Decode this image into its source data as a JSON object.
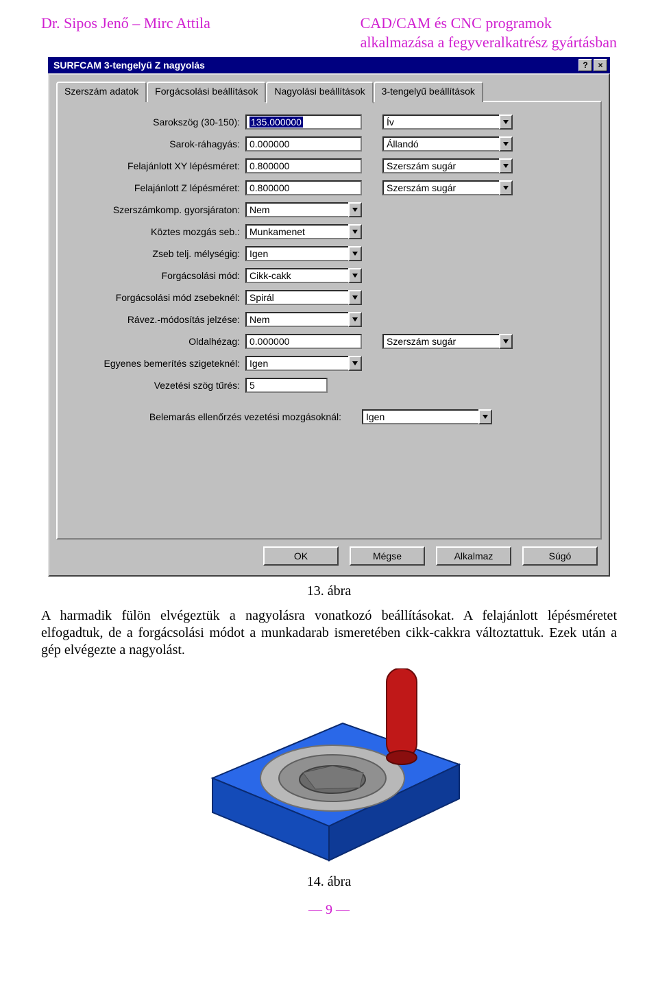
{
  "header": {
    "left": "Dr. Sipos Jenő – Mirc Attila",
    "right_line1": "CAD/CAM és CNC programok",
    "right_line2": "alkalmazása a fegyveralkatrész gyártásban"
  },
  "dialog": {
    "title": "SURFCAM 3-tengelyű Z nagyolás",
    "help_btn": "?",
    "close_btn": "×",
    "tabs": [
      {
        "label": "Szerszám adatok",
        "active": false
      },
      {
        "label": "Forgácsolási beállítások",
        "active": false
      },
      {
        "label": "Nagyolási  beállítások",
        "active": true
      },
      {
        "label": "3-tengelyű beállítások",
        "active": false
      }
    ],
    "rows": [
      {
        "label": "Sarokszög (30-150):",
        "value": "135.000000",
        "highlight": true,
        "combo": false,
        "right": {
          "value": "Ív",
          "combo": true
        }
      },
      {
        "label": "Sarok-ráhagyás:",
        "value": "0.000000",
        "combo": false,
        "right": {
          "value": "Állandó",
          "combo": true
        }
      },
      {
        "label": "Felajánlott XY lépésméret:",
        "value": "0.800000",
        "combo": false,
        "right": {
          "value": "Szerszám sugár",
          "combo": true
        }
      },
      {
        "label": "Felajánlott Z lépésméret:",
        "value": "0.800000",
        "combo": false,
        "right": {
          "value": "Szerszám sugár",
          "combo": true
        }
      },
      {
        "label": "Szerszámkomp. gyorsjáraton:",
        "value": "Nem",
        "combo": true
      },
      {
        "label": "Köztes mozgás seb.:",
        "value": "Munkamenet",
        "combo": true
      },
      {
        "label": "Zseb telj. mélységig:",
        "value": "Igen",
        "combo": true
      },
      {
        "label": "Forgácsolási mód:",
        "value": "Cikk-cakk",
        "combo": true
      },
      {
        "label": "Forgácsolási mód zsebeknél:",
        "value": "Spirál",
        "combo": true
      },
      {
        "label": "Rávez.-módosítás jelzése:",
        "value": "Nem",
        "combo": true
      },
      {
        "label": "Oldalhézag:",
        "value": "0.000000",
        "combo": false,
        "right": {
          "value": "Szerszám sugár",
          "combo": true
        }
      },
      {
        "label": "Egyenes bemerítés szigeteknél:",
        "value": "Igen",
        "combo": true
      },
      {
        "label": "Vezetési szög tűrés:",
        "value": "5",
        "combo": false
      }
    ],
    "long_row": {
      "label": "Belemarás ellenőrzés vezetési mozgásoknál:",
      "value": "Igen"
    },
    "buttons": {
      "ok": "OK",
      "cancel": "Mégse",
      "apply": "Alkalmaz",
      "help": "Súgó"
    }
  },
  "caption1": "13. ábra",
  "paragraph": "A harmadik fülön elvégeztük a nagyolásra vonatkozó beállításokat. A felajánlott lépésméretet elfogadtuk, de a forgácsolási módot a munkadarab ismeretében cikk-cakkra változtattuk. Ezek után a gép elvégezte a nagyolást.",
  "caption2": "14. ábra",
  "pagenum": "— 9 —"
}
